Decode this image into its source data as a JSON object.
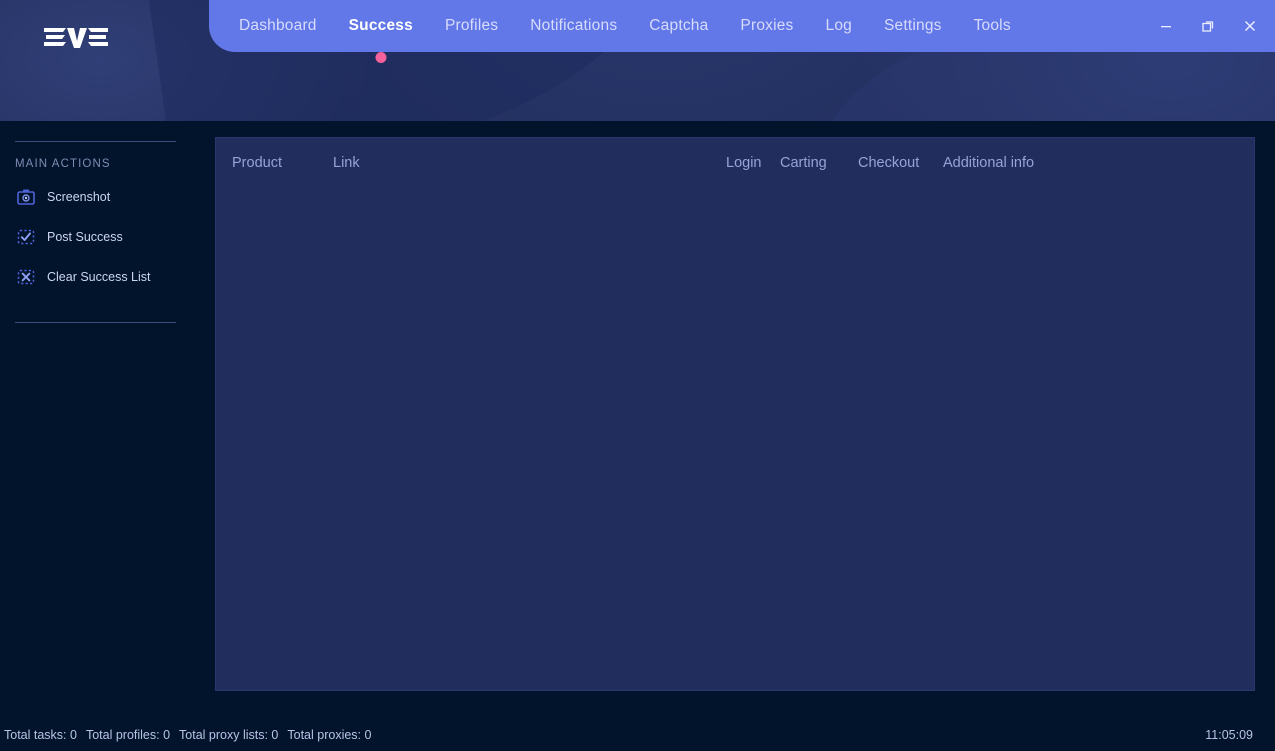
{
  "app": {
    "logo_text": "EVE",
    "accent_blue": "#6277e8",
    "accent_pink": "#f4629b",
    "panel_bg": "#212d5d",
    "page_bg": "#02132c",
    "header_bg": "#222f5e"
  },
  "nav": {
    "items": [
      {
        "label": "Dashboard",
        "active": false
      },
      {
        "label": "Success",
        "active": true
      },
      {
        "label": "Profiles",
        "active": false
      },
      {
        "label": "Notifications",
        "active": false
      },
      {
        "label": "Captcha",
        "active": false
      },
      {
        "label": "Proxies",
        "active": false
      },
      {
        "label": "Log",
        "active": false
      },
      {
        "label": "Settings",
        "active": false
      },
      {
        "label": "Tools",
        "active": false
      }
    ]
  },
  "window_controls": {
    "minimize": "minimize-icon",
    "restore": "restore-icon",
    "close": "close-icon"
  },
  "sidebar": {
    "title": "MAIN ACTIONS",
    "items": [
      {
        "label": "Screenshot",
        "icon": "camera-icon"
      },
      {
        "label": "Post Success",
        "icon": "check-box-icon"
      },
      {
        "label": "Clear Success List",
        "icon": "cross-box-icon"
      }
    ]
  },
  "main": {
    "columns": [
      {
        "label": "Product"
      },
      {
        "label": "Link"
      },
      {
        "label": "Login"
      },
      {
        "label": "Carting"
      },
      {
        "label": "Checkout"
      },
      {
        "label": "Additional info"
      }
    ],
    "rows": []
  },
  "status": {
    "total_tasks": "Total tasks: 0",
    "total_profiles": "Total profiles: 0",
    "total_proxy_lists": "Total proxy lists: 0",
    "total_proxies": "Total proxies: 0",
    "time": "11:05:09"
  }
}
